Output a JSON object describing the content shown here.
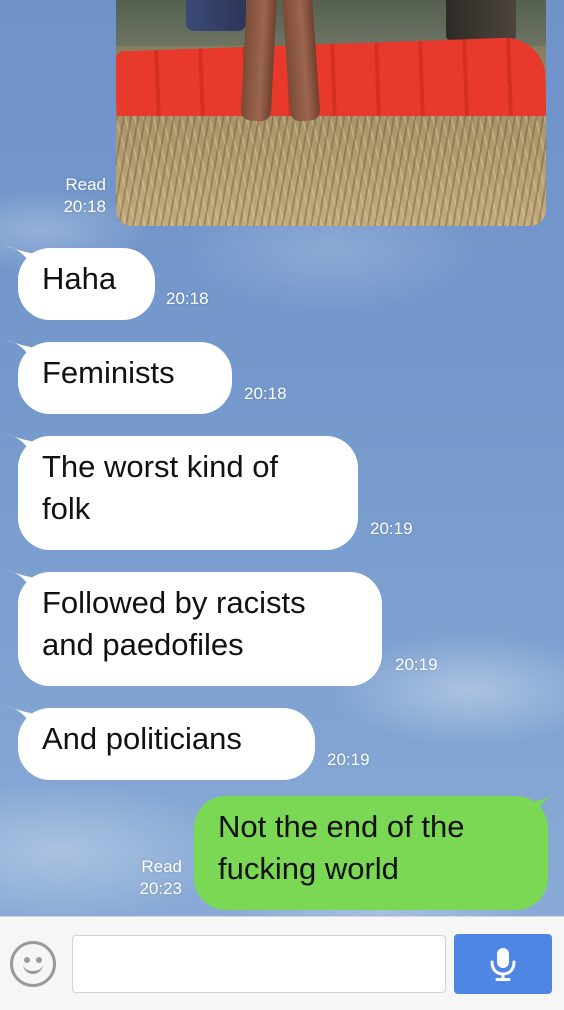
{
  "photo_message": {
    "status": "Read",
    "time": "20:18"
  },
  "messages": [
    {
      "direction": "incoming",
      "text": "Haha",
      "time": "20:18"
    },
    {
      "direction": "incoming",
      "text": "Feminists",
      "time": "20:18"
    },
    {
      "direction": "incoming",
      "text_lines": [
        "The worst kind of",
        "folk"
      ],
      "time": "20:19"
    },
    {
      "direction": "incoming",
      "text_lines": [
        "Followed by racists",
        "and paedofiles"
      ],
      "time": "20:19"
    },
    {
      "direction": "incoming",
      "text": "And politicians",
      "time": "20:19"
    },
    {
      "direction": "outgoing",
      "text_lines": [
        "Not the end of the",
        "fucking world"
      ],
      "time": "20:23",
      "status": "Read"
    }
  ],
  "input_bar": {
    "placeholder": "",
    "emoji_icon": "smiley-icon",
    "mic_icon": "microphone-icon"
  },
  "colors": {
    "outgoing_bubble": "#7ad854",
    "incoming_bubble": "#ffffff",
    "mic_button": "#4f86e3",
    "chat_background": "#7599cc"
  }
}
